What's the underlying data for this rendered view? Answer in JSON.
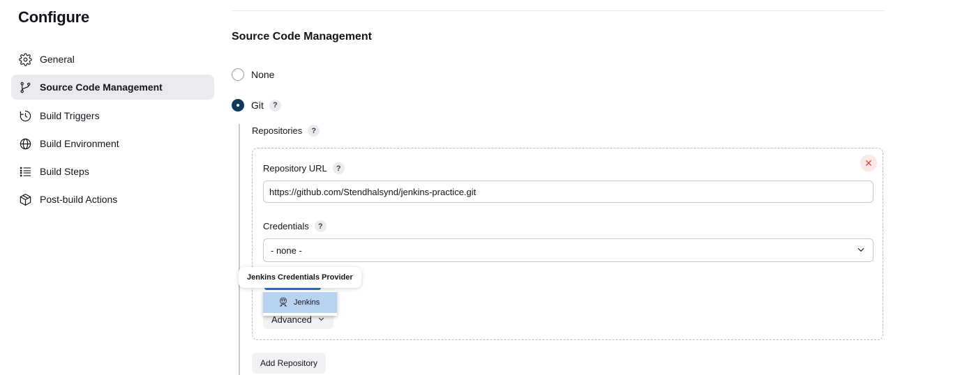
{
  "page": {
    "title": "Configure"
  },
  "sidebar": {
    "items": [
      {
        "label": "General",
        "icon": "gear-icon",
        "active": false
      },
      {
        "label": "Source Code Management",
        "icon": "git-branch-icon",
        "active": true
      },
      {
        "label": "Build Triggers",
        "icon": "timer-icon",
        "active": false
      },
      {
        "label": "Build Environment",
        "icon": "globe-icon",
        "active": false
      },
      {
        "label": "Build Steps",
        "icon": "list-icon",
        "active": false
      },
      {
        "label": "Post-build Actions",
        "icon": "package-icon",
        "active": false
      }
    ]
  },
  "scm": {
    "section_title": "Source Code Management",
    "options": [
      {
        "label": "None",
        "selected": false
      },
      {
        "label": "Git",
        "selected": true,
        "help": "?"
      }
    ],
    "repositories": {
      "label": "Repositories",
      "help": "?",
      "repository_url": {
        "label": "Repository URL",
        "help": "?",
        "value": "https://github.com/Stendhalsynd/jenkins-practice.git"
      },
      "credentials": {
        "label": "Credentials",
        "help": "?",
        "selected": "- none -"
      },
      "close_symbol": "✕",
      "advanced_label": "Advanced",
      "add_repository_label": "Add Repository"
    },
    "credentials_provider_tooltip": "Jenkins Credentials Provider",
    "credentials_dropdown": {
      "items": [
        {
          "label": "Jenkins",
          "icon": "jenkins-icon"
        }
      ]
    }
  },
  "colors": {
    "accent": "#0d3a5c",
    "active_bg": "#ebebef",
    "dropdown_highlight": "#b8d3f2",
    "danger": "#e0474a"
  }
}
